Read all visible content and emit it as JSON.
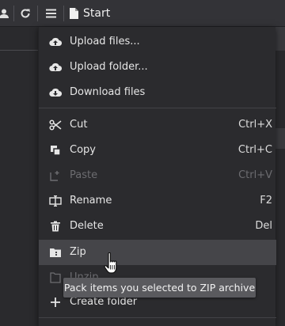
{
  "toolbar": {
    "path_label": "Start"
  },
  "menu": {
    "items": [
      {
        "label": "Upload files...",
        "shortcut": "",
        "icon": "cloud-upload-icon"
      },
      {
        "label": "Upload folder...",
        "shortcut": "",
        "icon": "cloud-upload-icon"
      },
      {
        "label": "Download files",
        "shortcut": "",
        "icon": "cloud-download-icon"
      },
      {
        "label": "Cut",
        "shortcut": "Ctrl+X",
        "icon": "scissors-icon"
      },
      {
        "label": "Copy",
        "shortcut": "Ctrl+C",
        "icon": "copy-icon"
      },
      {
        "label": "Paste",
        "shortcut": "Ctrl+V",
        "icon": "paste-icon",
        "disabled": true
      },
      {
        "label": "Rename",
        "shortcut": "F2",
        "icon": "rename-icon"
      },
      {
        "label": "Delete",
        "shortcut": "Del",
        "icon": "trash-icon"
      },
      {
        "label": "Zip",
        "shortcut": "",
        "icon": "zip-folder-icon",
        "hover": true
      },
      {
        "label": "Unzip",
        "shortcut": "",
        "icon": "unzip-icon",
        "disabled": true
      },
      {
        "label": "Create folder",
        "shortcut": "",
        "icon": "plus-icon"
      }
    ]
  },
  "tooltip": {
    "text": "Pack items you selected to ZIP archive"
  },
  "colors": {
    "menu_bg": "#2b2b2e",
    "hover_bg": "#454549",
    "tooltip_bg": "#5a5a5e",
    "disabled_text": "#6c6c70"
  }
}
